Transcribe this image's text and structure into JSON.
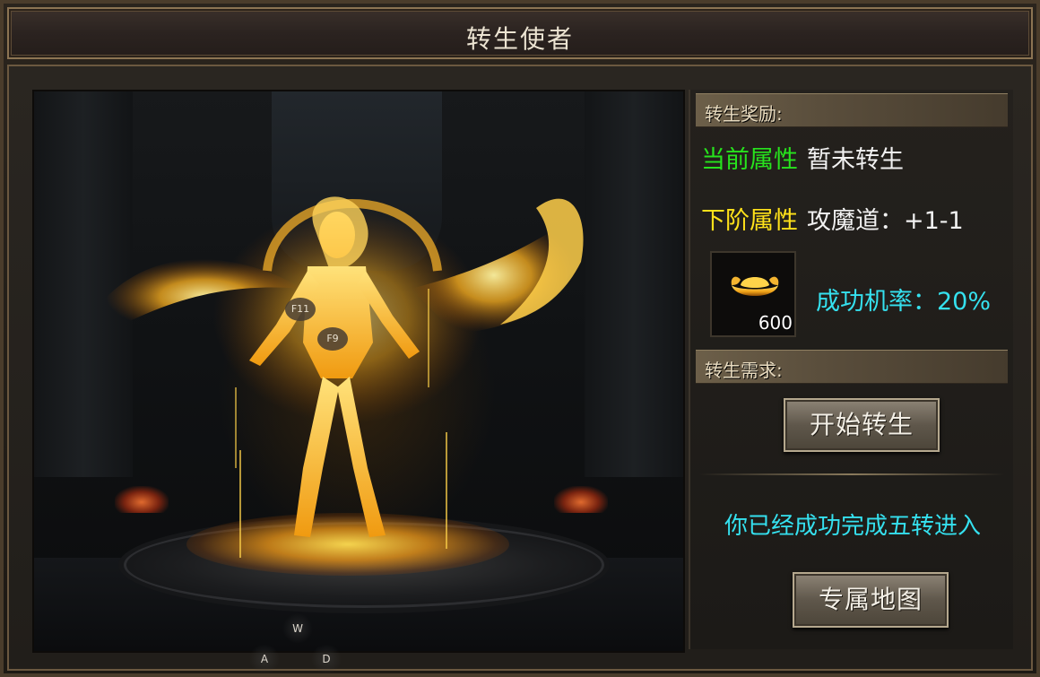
{
  "window": {
    "title": "转生使者"
  },
  "scene": {
    "markers": [
      "F11",
      "F9"
    ],
    "key_hints": [
      "W",
      "A",
      "D"
    ]
  },
  "reward": {
    "header": "转生奖励:",
    "current_label": "当前属性",
    "current_value": "暂未转生",
    "next_label": "下阶属性",
    "next_value": "攻魔道：+1-1",
    "item_icon": "gold-ingot-icon",
    "item_count": "600",
    "success_rate": "成功机率：20%"
  },
  "requirement": {
    "header": "转生需求:",
    "start_button": "开始转生",
    "info_text": "你已经成功完成五转进入",
    "map_button": "专属地图"
  },
  "colors": {
    "green": "#27e31d",
    "yellow": "#ffe21a",
    "cyan": "#35e1ef"
  }
}
